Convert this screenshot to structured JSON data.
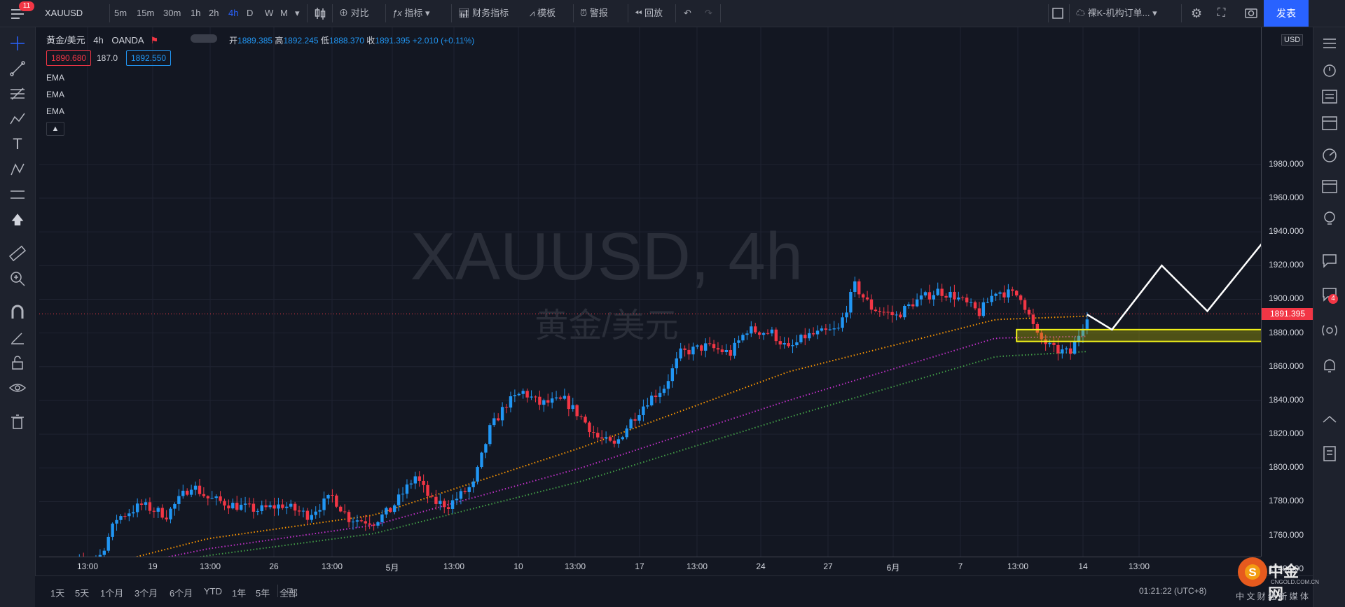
{
  "topbar": {
    "menu_badge": "11",
    "symbol": "XAUUSD",
    "timeframes": [
      "5m",
      "15m",
      "30m",
      "1h",
      "2h",
      "4h",
      "D",
      "W",
      "M"
    ],
    "active_timeframe": "4h",
    "compare": "对比",
    "indicators": "指标",
    "financials": "财务指标",
    "templates": "模板",
    "alert": "警报",
    "replay": "回放",
    "layout_name": "裸K-机构订单...",
    "publish": "发表"
  },
  "legend": {
    "title": "黄金/美元",
    "interval": "4h",
    "source": "OANDA",
    "o_label": "开",
    "o": "1889.385",
    "h_label": "高",
    "h": "1892.245",
    "l_label": "低",
    "l": "1888.370",
    "c_label": "收",
    "c": "1891.395",
    "change": "+2.010 (+0.11%)",
    "sell": "1890.680",
    "spread": "187.0",
    "buy": "1892.550",
    "indicators": [
      "EMA",
      "EMA",
      "EMA"
    ]
  },
  "watermark": {
    "main": "XAUUSD, 4h",
    "sub": "黄金/美元"
  },
  "price_axis": {
    "currency": "USD",
    "labels": [
      "1980.000",
      "1960.000",
      "1940.000",
      "1920.000",
      "1900.000",
      "1880.000",
      "1860.000",
      "1840.000",
      "1820.000",
      "1800.000",
      "1780.000",
      "1760.000",
      "1740.000"
    ],
    "last_price": "1891.395"
  },
  "time_axis": {
    "labels": [
      "13:00",
      "19",
      "13:00",
      "26",
      "13:00",
      "5月",
      "13:00",
      "10",
      "13:00",
      "17",
      "13:00",
      "24",
      "27",
      "6月",
      "7",
      "13:00",
      "14",
      "13:00"
    ]
  },
  "bottombar": {
    "ranges": [
      "1天",
      "5天",
      "1个月",
      "3个月",
      "6个月",
      "YTD",
      "1年",
      "5年",
      "全部"
    ],
    "clock": "01:21:22 (UTC+8)",
    "site": "中金网",
    "site_url": "CNGOLD.COM.CN",
    "site_tags": "中 文 财 经 新 媒 体"
  },
  "right_panel": {
    "badge": "4"
  },
  "colors": {
    "up": "#2196f3",
    "down": "#f23645",
    "ema1": "#ff9800",
    "ema2": "#c030c8",
    "ema3": "#43a047",
    "zone": "#f2f21a",
    "accent": "#2962ff"
  },
  "chart_data": {
    "type": "candlestick",
    "symbol": "XAUUSD",
    "interval": "4h",
    "ylim": [
      1730,
      1985
    ],
    "last_price": 1891.395,
    "candle_count": 195,
    "price_path_anchors": [
      [
        0,
        1733
      ],
      [
        8,
        1742
      ],
      [
        14,
        1748
      ],
      [
        18,
        1770
      ],
      [
        24,
        1778
      ],
      [
        30,
        1772
      ],
      [
        36,
        1790
      ],
      [
        40,
        1782
      ],
      [
        46,
        1778
      ],
      [
        52,
        1775
      ],
      [
        58,
        1778
      ],
      [
        64,
        1772
      ],
      [
        70,
        1783
      ],
      [
        74,
        1770
      ],
      [
        80,
        1768
      ],
      [
        84,
        1775
      ],
      [
        90,
        1795
      ],
      [
        94,
        1780
      ],
      [
        98,
        1778
      ],
      [
        104,
        1790
      ],
      [
        108,
        1823
      ],
      [
        112,
        1838
      ],
      [
        116,
        1845
      ],
      [
        120,
        1838
      ],
      [
        126,
        1840
      ],
      [
        130,
        1830
      ],
      [
        134,
        1818
      ],
      [
        138,
        1813
      ],
      [
        142,
        1828
      ],
      [
        146,
        1840
      ],
      [
        150,
        1848
      ],
      [
        154,
        1868
      ],
      [
        160,
        1872
      ],
      [
        166,
        1868
      ],
      [
        170,
        1882
      ],
      [
        176,
        1880
      ],
      [
        180,
        1870
      ],
      [
        184,
        1878
      ],
      [
        188,
        1880
      ],
      [
        192,
        1882
      ],
      [
        196,
        1908
      ],
      [
        200,
        1895
      ],
      [
        206,
        1890
      ],
      [
        210,
        1898
      ],
      [
        216,
        1905
      ],
      [
        220,
        1902
      ],
      [
        226,
        1892
      ],
      [
        230,
        1905
      ],
      [
        236,
        1902
      ],
      [
        240,
        1878
      ],
      [
        244,
        1870
      ],
      [
        248,
        1868
      ],
      [
        252,
        1891
      ]
    ],
    "ema_series": [
      {
        "name": "EMA",
        "color": "#ff9800",
        "anchors": [
          [
            0,
            1733
          ],
          [
            40,
            1758
          ],
          [
            80,
            1772
          ],
          [
            130,
            1812
          ],
          [
            180,
            1857
          ],
          [
            230,
            1888
          ],
          [
            252,
            1890
          ]
        ]
      },
      {
        "name": "EMA",
        "color": "#c030c8",
        "anchors": [
          [
            0,
            1732
          ],
          [
            40,
            1752
          ],
          [
            80,
            1766
          ],
          [
            130,
            1800
          ],
          [
            180,
            1840
          ],
          [
            230,
            1877
          ],
          [
            252,
            1878
          ]
        ]
      },
      {
        "name": "EMA",
        "color": "#43a047",
        "anchors": [
          [
            0,
            1730
          ],
          [
            40,
            1748
          ],
          [
            80,
            1761
          ],
          [
            130,
            1792
          ],
          [
            180,
            1830
          ],
          [
            230,
            1866
          ],
          [
            252,
            1869
          ]
        ]
      }
    ],
    "zone": {
      "from_index": 235,
      "to_index": 300,
      "top": 1882,
      "bottom": 1875
    },
    "projection": [
      [
        252,
        1891
      ],
      [
        258,
        1882
      ],
      [
        270,
        1920
      ],
      [
        281,
        1893
      ],
      [
        303,
        1960
      ]
    ]
  }
}
